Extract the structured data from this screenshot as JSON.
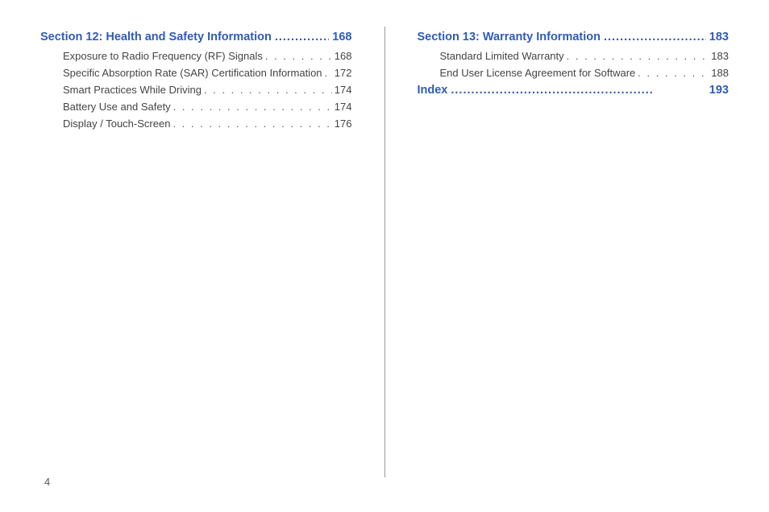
{
  "page_number": "4",
  "dots_header": "..................................................",
  "dots_entry": ". . . . . . . . . . . . . . . . . . . . . . . . . . . . . . . . . . . . . . . . . . . . . . . . . . . . . . . . . . . .",
  "left_column": {
    "section": {
      "title": "Section 12:  Health and Safety Information ",
      "page": "168"
    },
    "entries": [
      {
        "title": "Exposure to Radio Frequency (RF) Signals  ",
        "page": "168"
      },
      {
        "title": "Specific Absorption Rate (SAR) Certification Information ",
        "page": "172"
      },
      {
        "title": "Smart Practices While Driving",
        "page": "174"
      },
      {
        "title": "Battery Use and Safety ",
        "page": "174"
      },
      {
        "title": "Display / Touch-Screen  ",
        "page": "176"
      }
    ]
  },
  "right_column": {
    "sections": [
      {
        "title": "Section 13:  Warranty Information ",
        "page": "183",
        "entries": [
          {
            "title": "Standard Limited Warranty",
            "page": "183"
          },
          {
            "title": "End User License Agreement for Software ",
            "page": "188"
          }
        ]
      },
      {
        "title": "Index ",
        "page": "193",
        "entries": []
      }
    ]
  }
}
